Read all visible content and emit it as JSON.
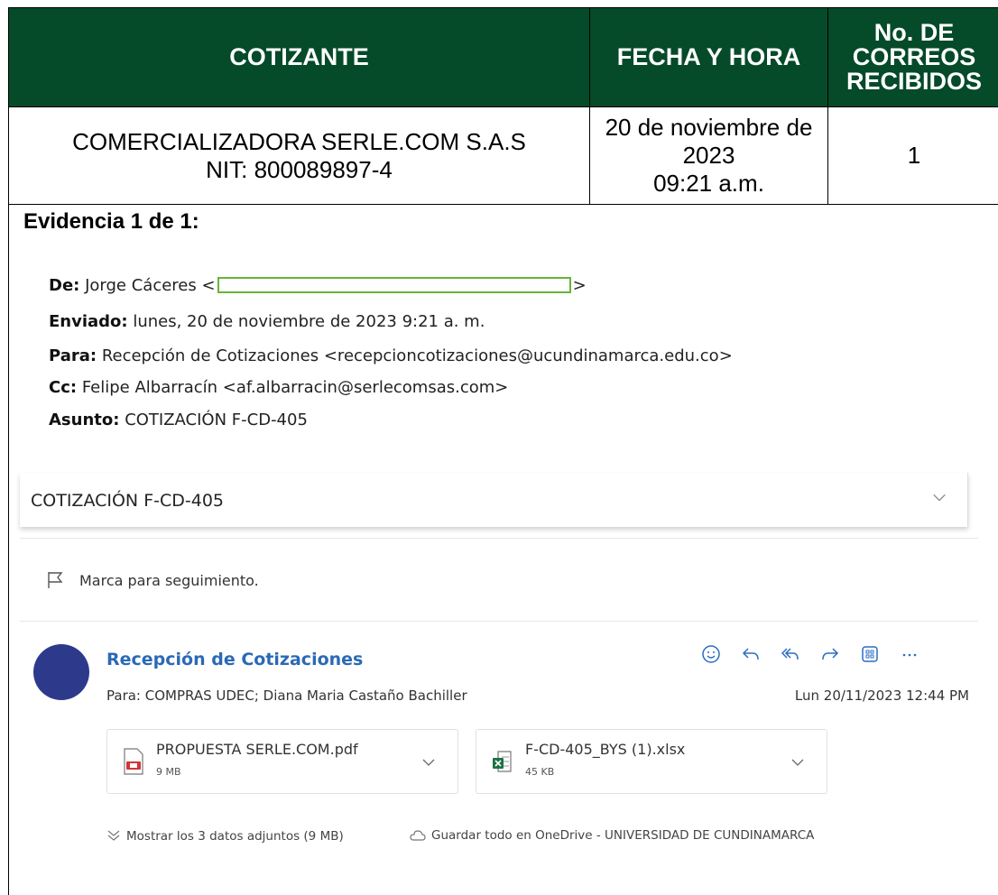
{
  "table": {
    "headers": [
      "COTIZANTE",
      "FECHA Y HORA",
      "No. DE CORREOS RECIBIDOS"
    ],
    "row": {
      "cotizante": "COMERCIALIZADORA SERLE.COM S.A.S",
      "nit": "NIT: 800089897-4",
      "fecha": "20 de noviembre de 2023",
      "hora": "09:21 a.m.",
      "correos": "1"
    }
  },
  "evidence_title": "Evidencia 1 de 1:",
  "email_header": {
    "from_label": "De:",
    "from_value": "Jorge Cáceres <",
    "from_close": ">",
    "sent_label": "Enviado:",
    "sent_value": "lunes, 20 de noviembre de 2023 9:21 a. m.",
    "to_label": "Para:",
    "to_value": "Recepción de Cotizaciones <recepcioncotizaciones@ucundinamarca.edu.co>",
    "cc_label": "Cc:",
    "cc_value": "Felipe Albarracín <af.albarracin@serlecomsas.com>",
    "subject_label": "Asunto:",
    "subject_value": "COTIZACIÓN F-CD-405"
  },
  "subject_bar": "COTIZACIÓN F-CD-405",
  "flag_text": "Marca para seguimiento.",
  "message": {
    "sender": "Recepción de Cotizaciones",
    "to": "Para:  COMPRAS UDEC;  Diana Maria Castaño Bachiller",
    "date": "Lun 20/11/2023 12:44 PM",
    "actions": [
      "emoji-icon",
      "reply-icon",
      "reply-all-icon",
      "forward-icon",
      "apps-icon",
      "more-icon"
    ],
    "attachments": [
      {
        "name": "PROPUESTA SERLE.COM.pdf",
        "size": "9 MB",
        "icon": "pdf-file-icon"
      },
      {
        "name": "F-CD-405_BYS (1).xlsx",
        "size": "45 KB",
        "icon": "excel-file-icon"
      }
    ],
    "show_all": "Mostrar los 3 datos adjuntos (9 MB)",
    "save_all": "Guardar todo en OneDrive - UNIVERSIDAD DE CUNDINAMARCA"
  },
  "colors": {
    "header_bg": "#054a29",
    "avatar": "#2d3a8c",
    "link": "#2a69b5",
    "accent_icons": "#2b6cc4"
  }
}
